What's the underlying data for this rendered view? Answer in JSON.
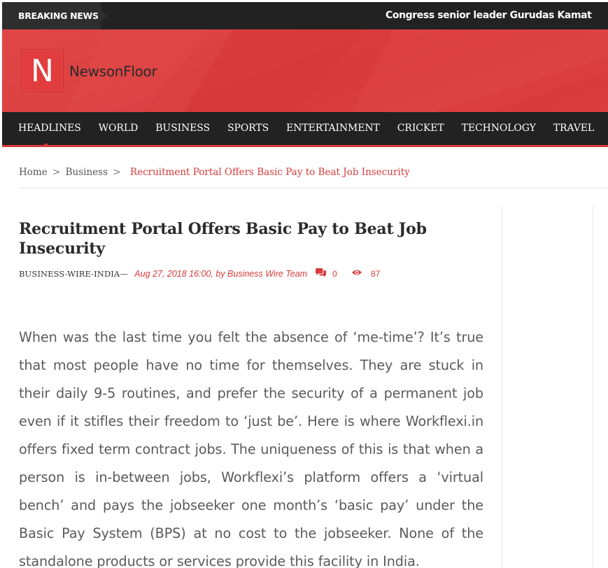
{
  "breaking": {
    "label": "BREAKING NEWS",
    "ticker": "Congress senior leader Gurudas Kamat passes away"
  },
  "brand": {
    "logo_letter": "N",
    "name": "NewsonFloor",
    "accent": "#d93a3b"
  },
  "nav": {
    "items": [
      "HEADLINES",
      "WORLD",
      "BUSINESS",
      "SPORTS",
      "ENTERTAINMENT",
      "CRICKET",
      "TECHNOLOGY",
      "TRAVEL"
    ],
    "active": "HEADLINES"
  },
  "breadcrumb": {
    "home": "Home",
    "sep": ">",
    "section": "Business",
    "current": "Recruitment Portal Offers Basic Pay to Beat Job Insecurity"
  },
  "article": {
    "title": "Recruitment Portal Offers Basic Pay to Beat Job Insecurity",
    "category": "BUSINESS-WIRE-INDIA",
    "dash": "—",
    "date_author": "Aug 27, 2018 16:00, by Business Wire Team",
    "comments": "0",
    "views": "87",
    "body": "When was the last time you felt the absence of ‘me-time’? It’s true that most people have no time for themselves. They are stuck in their daily 9-5 routines, and prefer the security of a permanent job even if it stifles their freedom to ‘just be’. Here is where Workflexi.in offers fixed term contract jobs. The uniqueness of this is that when a person is in-between jobs, Workflexi’s platform offers a ‘virtual bench’ and pays the jobseeker one month’s ‘basic pay’ under the Basic Pay System (BPS) at no cost to the jobseeker. None of the standalone products or services provide this facility in India."
  },
  "icons": {
    "comments": "comments-icon",
    "views": "eye-icon"
  }
}
